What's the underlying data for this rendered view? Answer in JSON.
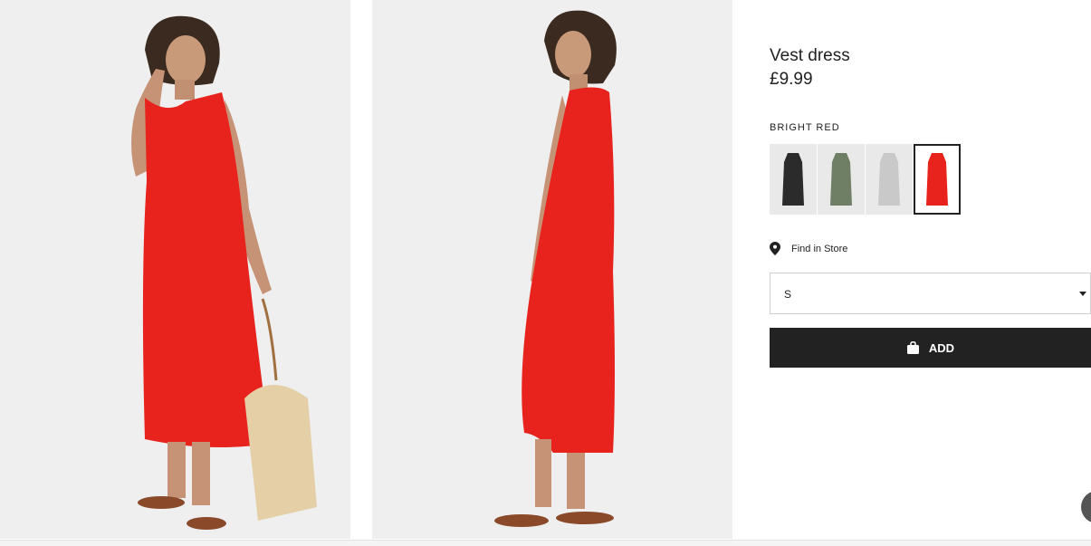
{
  "product": {
    "title": "Vest dress",
    "price": "£9.99",
    "color_name": "BRIGHT RED",
    "swatches": [
      {
        "name": "black",
        "color": "#2b2b2b"
      },
      {
        "name": "green",
        "color": "#6f7f66"
      },
      {
        "name": "light grey",
        "color": "#c9c9c9"
      },
      {
        "name": "bright red",
        "color": "#e8231d",
        "selected": true
      }
    ]
  },
  "store": {
    "label": "Find in Store",
    "icon": "location-pin-icon"
  },
  "size_select": {
    "value": "S",
    "icon": "caret-down-icon"
  },
  "add_button": {
    "label": "ADD",
    "icon": "shopping-bag-icon"
  },
  "colors": {
    "dress": "#e8231d",
    "button": "#222222",
    "background": "#efefef"
  }
}
